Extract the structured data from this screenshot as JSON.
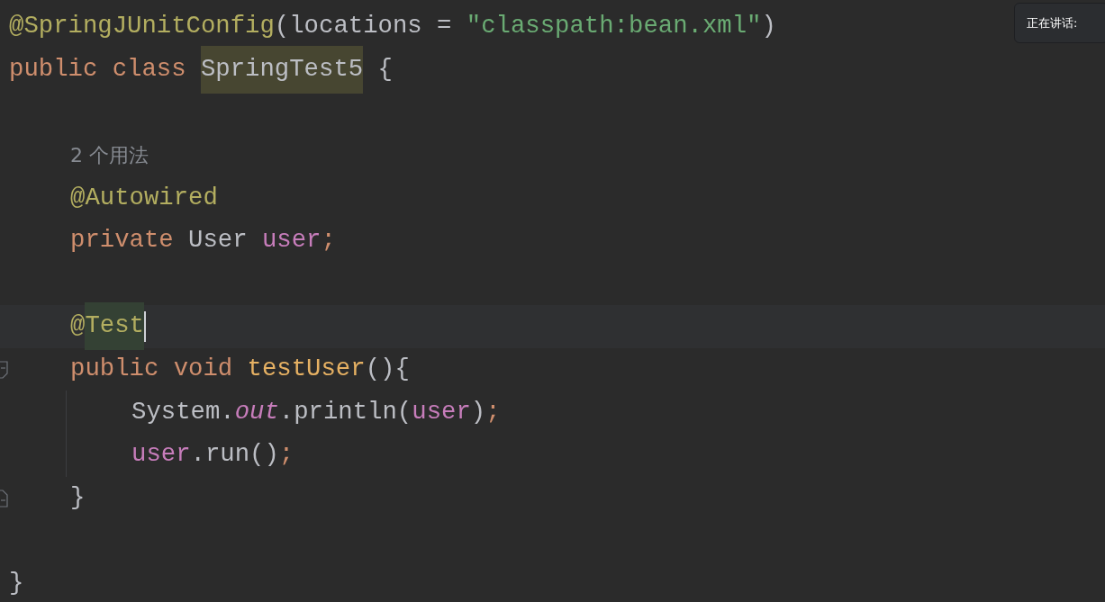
{
  "editor": {
    "lines": [
      {
        "kind": "code",
        "tokens": [
          {
            "text": "@SpringJUnitConfig",
            "kind": "annotation"
          },
          {
            "text": "(locations = ",
            "kind": "plain"
          },
          {
            "text": "\"classpath:bean.xml\"",
            "kind": "string"
          },
          {
            "text": ")",
            "kind": "plain"
          }
        ]
      },
      {
        "kind": "code",
        "tokens": [
          {
            "text": "public class ",
            "kind": "keyword"
          },
          {
            "text": "SpringTest5",
            "kind": "plain",
            "highlighted": true
          },
          {
            "text": " {",
            "kind": "plain"
          }
        ],
        "children": [
          {
            "kind": "blank"
          },
          {
            "kind": "hint",
            "text": "2 个用法"
          },
          {
            "kind": "code",
            "tokens": [
              {
                "text": "@Autowired",
                "kind": "annotation"
              }
            ]
          },
          {
            "kind": "code",
            "tokens": [
              {
                "text": "private ",
                "kind": "keyword"
              },
              {
                "text": "User ",
                "kind": "plain"
              },
              {
                "text": "user",
                "kind": "field"
              },
              {
                "text": ";",
                "kind": "semicolon"
              }
            ]
          },
          {
            "kind": "blank"
          },
          {
            "kind": "code",
            "current": true,
            "caret": true,
            "tokens": [
              {
                "text": "@",
                "kind": "annotation"
              },
              {
                "text": "Test",
                "kind": "annotation",
                "highlighted": true
              }
            ]
          },
          {
            "kind": "code",
            "fold_start": true,
            "tokens": [
              {
                "text": "public void ",
                "kind": "keyword"
              },
              {
                "text": "testUser",
                "kind": "method"
              },
              {
                "text": "(){",
                "kind": "plain"
              }
            ],
            "children": [
              {
                "kind": "code",
                "tokens": [
                  {
                    "text": "System.",
                    "kind": "plain"
                  },
                  {
                    "text": "out",
                    "kind": "static"
                  },
                  {
                    "text": ".println(",
                    "kind": "plain"
                  },
                  {
                    "text": "user",
                    "kind": "field"
                  },
                  {
                    "text": ")",
                    "kind": "plain"
                  },
                  {
                    "text": ";",
                    "kind": "semicolon"
                  }
                ]
              },
              {
                "kind": "code",
                "tokens": [
                  {
                    "text": "user",
                    "kind": "field"
                  },
                  {
                    "text": ".run()",
                    "kind": "plain"
                  },
                  {
                    "text": ";",
                    "kind": "semicolon"
                  }
                ]
              }
            ]
          },
          {
            "kind": "code",
            "fold_end": true,
            "tokens": [
              {
                "text": "}",
                "kind": "plain"
              }
            ]
          },
          {
            "kind": "blank"
          }
        ]
      },
      {
        "kind": "code",
        "tokens": [
          {
            "text": "}",
            "kind": "plain"
          }
        ]
      }
    ]
  },
  "speaking_overlay": {
    "label": "正在讲话:"
  }
}
